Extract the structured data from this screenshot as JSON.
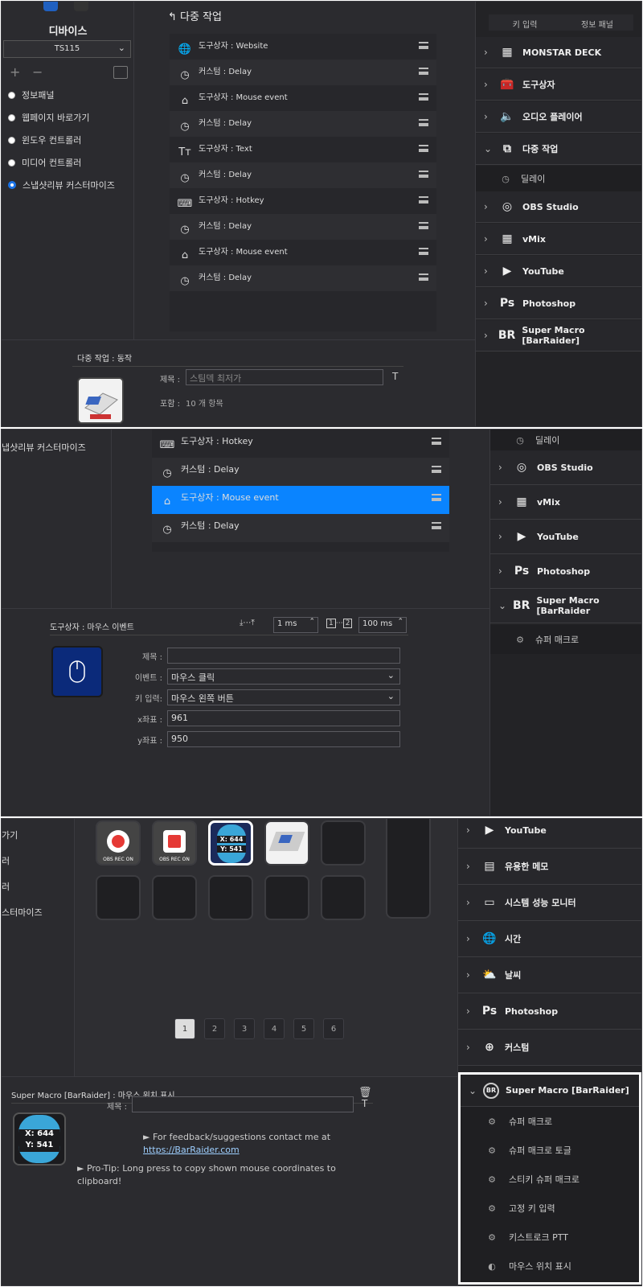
{
  "p1": {
    "sidebar": {
      "title": "디바이스",
      "device": "TS115",
      "items": [
        {
          "label": "정보패널",
          "selected": false
        },
        {
          "label": "웹페이지 바로가기",
          "selected": false
        },
        {
          "label": "윈도우 컨트롤러",
          "selected": false
        },
        {
          "label": "미디어 컨트롤러",
          "selected": false
        },
        {
          "label": "스냅샷리뷰 커스터마이즈",
          "selected": true
        }
      ]
    },
    "back_title": "다중 작업",
    "actions": [
      {
        "icon": "globe-icon",
        "label": "도구상자 : Website"
      },
      {
        "icon": "timer-icon",
        "label": "커스텀 : Delay"
      },
      {
        "icon": "mouse-icon",
        "label": "도구상자 : Mouse event"
      },
      {
        "icon": "timer-icon",
        "label": "커스텀 : Delay"
      },
      {
        "icon": "text-icon",
        "label": "도구상자 : Text"
      },
      {
        "icon": "timer-icon",
        "label": "커스텀 : Delay"
      },
      {
        "icon": "keyboard-icon",
        "label": "도구상자 : Hotkey"
      },
      {
        "icon": "timer-icon",
        "label": "커스텀 : Delay"
      },
      {
        "icon": "mouse-icon",
        "label": "도구상자 : Mouse event"
      },
      {
        "icon": "timer-icon",
        "label": "커스텀 : Delay"
      }
    ],
    "tabs": [
      "키 입력",
      "정보 패널"
    ],
    "right_items": [
      {
        "label": "MONSTAR DECK",
        "chev": "›"
      },
      {
        "label": "도구상자",
        "chev": "›"
      },
      {
        "label": "오디오 플레이어",
        "chev": "›"
      },
      {
        "label": "다중 작업",
        "chev": "⌄"
      },
      {
        "label": "OBS Studio",
        "chev": "›"
      },
      {
        "label": "vMix",
        "chev": "›"
      },
      {
        "label": "YouTube",
        "chev": "›"
      },
      {
        "label": "Photoshop",
        "chev": "›"
      },
      {
        "label": "Super Macro [BarRaider]",
        "chev": "›"
      }
    ],
    "sub_item": "딜레이",
    "bottom": {
      "heading": "다중 작업 : 동작",
      "title_label": "제목 :",
      "title_value": "스팀덱 최저가",
      "contains_label": "포함 :",
      "contains_value": "10 개 항목",
      "t_icon": "T"
    }
  },
  "p2": {
    "partial_left": "냅샷리뷰 커스터마이즈",
    "actions": [
      {
        "icon": "keyboard-icon",
        "label": "도구상자 : Hotkey",
        "selected": false
      },
      {
        "icon": "timer-icon",
        "label": "커스텀 : Delay",
        "selected": false
      },
      {
        "icon": "mouse-icon",
        "label": "도구상자 : Mouse event",
        "selected": true
      },
      {
        "icon": "timer-icon",
        "label": "커스텀 : Delay",
        "selected": false
      }
    ],
    "right_sub": "딜레이",
    "right_items": [
      {
        "label": "OBS Studio",
        "chev": "›"
      },
      {
        "label": "vMix",
        "chev": "›"
      },
      {
        "label": "YouTube",
        "chev": "›"
      },
      {
        "label": "Photoshop",
        "chev": "›"
      },
      {
        "label": "Super Macro [BarRaider",
        "chev": "⌄"
      }
    ],
    "right_sub2": "슈퍼 매크로",
    "form": {
      "heading": "도구상자 : 마우스 이벤트",
      "delay1": "1 ms",
      "delay2": "100 ms",
      "step1": "1",
      "step2": "2",
      "rows": [
        {
          "label": "제목 :",
          "value": "",
          "type": "text"
        },
        {
          "label": "이벤트 :",
          "value": "마우스 클릭",
          "type": "select"
        },
        {
          "label": "키 입력:",
          "value": "마우스 왼쪽 버튼",
          "type": "select"
        },
        {
          "label": "x좌표 :",
          "value": "961",
          "type": "text"
        },
        {
          "label": "y좌표 :",
          "value": "950",
          "type": "text"
        }
      ]
    }
  },
  "p3": {
    "left_partial": [
      "가기",
      "러",
      "러",
      "스터마이즈"
    ],
    "keys": [
      {
        "label": "OBS REC ON",
        "kind": "rec-circle"
      },
      {
        "label": "OBS REC ON",
        "kind": "rec-square"
      },
      {
        "label": "",
        "kind": "mouse-coord",
        "x": "X: 644",
        "y": "Y: 541"
      },
      {
        "label": "",
        "kind": "deck-image"
      }
    ],
    "pages": [
      "1",
      "2",
      "3",
      "4",
      "5",
      "6"
    ],
    "right_items": [
      {
        "label": "YouTube",
        "chev": "›"
      },
      {
        "label": "유용한 메모",
        "chev": "›"
      },
      {
        "label": "시스템 성능 모니터",
        "chev": "›"
      },
      {
        "label": "시간",
        "chev": "›"
      },
      {
        "label": "날씨",
        "chev": "›"
      },
      {
        "label": "Photoshop",
        "chev": "›"
      },
      {
        "label": "커스텀",
        "chev": "›"
      }
    ],
    "macro_group": {
      "label": "Super Macro [BarRaider]",
      "chev": "⌄",
      "items": [
        "슈퍼 매크로",
        "슈퍼 매크로 토글",
        "스티키 슈퍼 매크로",
        "고정 키 입력",
        "키스트로크 PTT",
        "마우스 위치 표시"
      ]
    },
    "detail": {
      "heading": "Super Macro [BarRaider] : 마우스 위치 표시",
      "title_label": "제목 :",
      "title_value": "",
      "t_icon": "T",
      "feedback": "► For feedback/suggestions contact me at",
      "link": "https://BarRaider.com",
      "tip": "► Pro-Tip: Long press to copy shown mouse coordinates to clipboard!",
      "coord_x": "X: 644",
      "coord_y": "Y: 541"
    }
  },
  "colors": {
    "accent": "#1a8cff",
    "panel": "#2b2b2f",
    "selected_row": "#0a84ff"
  }
}
